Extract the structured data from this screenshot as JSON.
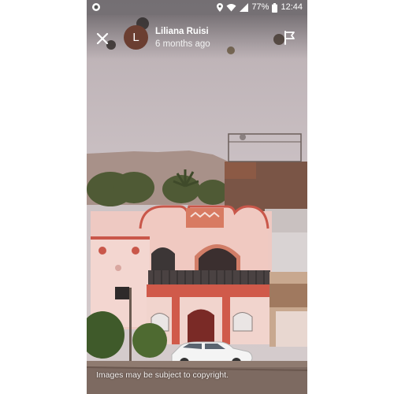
{
  "status_bar": {
    "time": "12:44",
    "battery": "77%",
    "icons": [
      "notification-icon",
      "location-icon",
      "wifi-icon",
      "signal-icon",
      "battery-icon"
    ]
  },
  "header": {
    "avatar_initial": "L",
    "avatar_color": "#6b3e31",
    "user_name": "Liliana Ruisi",
    "time_ago": "6 months ago",
    "icons": [
      "close-icon",
      "flag-icon"
    ]
  },
  "photo": {
    "description_icon": "street-photo"
  },
  "footer": {
    "copyright": "Images may be subject to copyright."
  }
}
